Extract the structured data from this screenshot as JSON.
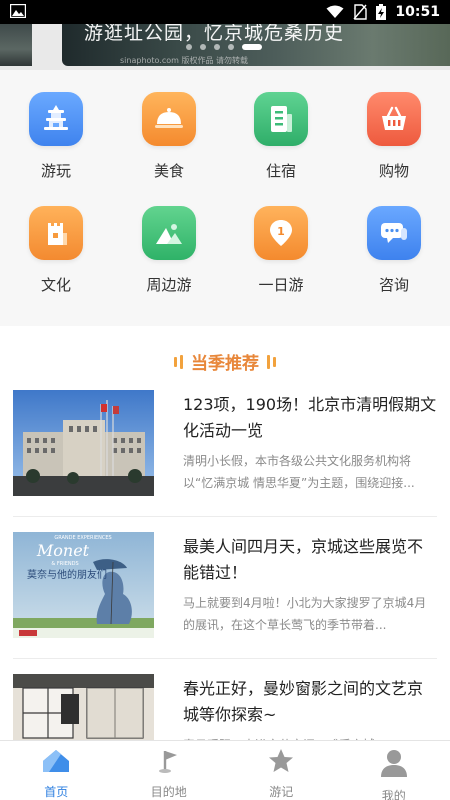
{
  "status_bar": {
    "time": "10:51",
    "icons": [
      "image-icon",
      "wifi-icon",
      "no-sim-icon",
      "battery-charging-icon"
    ]
  },
  "banner": {
    "title": "游逛址公园，忆京城危桑历史",
    "credit": "sinaphoto.com 版权作品 请勿转载",
    "slide_count": 5,
    "active_slide": 5
  },
  "categories": [
    {
      "label": "游玩",
      "icon": "pagoda-icon",
      "color": "#4a8ff0"
    },
    {
      "label": "美食",
      "icon": "food-cloche-icon",
      "color": "#f79a3c"
    },
    {
      "label": "住宿",
      "icon": "hotel-building-icon",
      "color": "#3dbb78"
    },
    {
      "label": "购物",
      "icon": "shopping-basket-icon",
      "color": "#f26b4d"
    },
    {
      "label": "文化",
      "icon": "great-wall-icon",
      "color": "#f7953a"
    },
    {
      "label": "周边游",
      "icon": "landscape-icon",
      "color": "#3fbd72"
    },
    {
      "label": "一日游",
      "icon": "day-marker-icon",
      "color": "#f79a3c"
    },
    {
      "label": "咨询",
      "icon": "chat-bubble-icon",
      "color": "#4a8ff0"
    }
  ],
  "recommend": {
    "heading": "当季推荐",
    "articles": [
      {
        "title": "123项，190场！北京市清明假期文化活动一览",
        "desc": "清明小长假，本市各级公共文化服务机构将以“忆满京城 情思华夏”为主题，围绕迎接..."
      },
      {
        "title": "最美人间四月天，京城这些展览不能错过！",
        "desc": "马上就要到4月啦！小北为大家搜罗了京城4月的展讯，在这个草长莺飞的季节带着..."
      },
      {
        "title": "春光正好，曼妙窗影之间的文艺京城等你探索~",
        "desc": "春日暖阳，走进文艺空间，感受京城..."
      }
    ],
    "thumb_text": {
      "monet_top": "GRANDE EXPERIENCES",
      "monet_name": "Monet",
      "monet_sub": "& FRIENDS",
      "monet_cn": "莫奈与他的朋友们"
    }
  },
  "tabbar": {
    "tabs": [
      {
        "label": "首页",
        "icon": "home-icon",
        "active": true
      },
      {
        "label": "目的地",
        "icon": "flag-pin-icon",
        "active": false
      },
      {
        "label": "游记",
        "icon": "star-icon",
        "active": false
      },
      {
        "label": "我的",
        "icon": "user-icon",
        "active": false
      }
    ],
    "active_color": "#2f80e0",
    "inactive_color": "#888888"
  }
}
